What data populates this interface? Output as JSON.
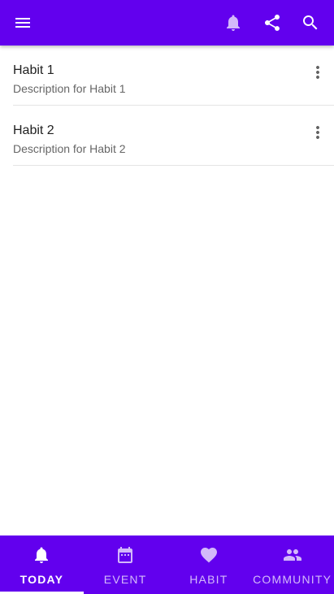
{
  "appbar": {
    "icons": [
      "menu-icon",
      "notifications-icon",
      "share-icon",
      "search-icon"
    ]
  },
  "habits": [
    {
      "title": "Habit 1",
      "description": "Description for Habit 1"
    },
    {
      "title": "Habit 2",
      "description": "Description for Habit 2"
    }
  ],
  "bottom_nav": {
    "active": "TODAY",
    "items": [
      {
        "label": "TODAY",
        "icon": "bell-icon"
      },
      {
        "label": "EVENT",
        "icon": "calendar-icon"
      },
      {
        "label": "HABIT",
        "icon": "heart-icon"
      },
      {
        "label": "COMMUNITY",
        "icon": "people-icon"
      }
    ]
  },
  "colors": {
    "primary": "#6200ee",
    "on_primary": "#ffffff",
    "divider": "#e4e4e4"
  }
}
